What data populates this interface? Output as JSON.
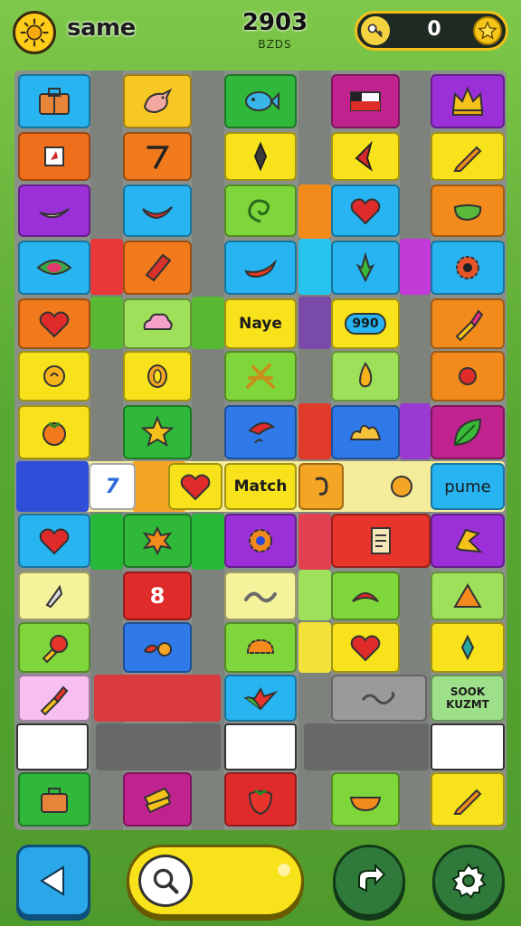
{
  "header": {
    "title": "same",
    "score": "2903",
    "score_sub": "BZDS",
    "coins": "0"
  },
  "board": {
    "tiles": {
      "r7c3_text": "Naye",
      "r7c4_text": "990",
      "r9c2_text": "7",
      "r9c3_text": "Match",
      "r9c5_text": "pume",
      "r11c2_text": "8",
      "r13c5_text": "SOOK KUZMT"
    }
  },
  "colors": {
    "background": "#5aa832",
    "board": "#8a8f8a",
    "accent_yellow": "#f7e21b",
    "button_blue": "#2aa7e8",
    "button_green": "#2f7a3a"
  },
  "controls": {
    "back_icon": "triangle-left-icon",
    "hint_icon": "magnifier-icon",
    "undo_icon": "undo-arrow-icon",
    "settings_icon": "gear-icon"
  }
}
